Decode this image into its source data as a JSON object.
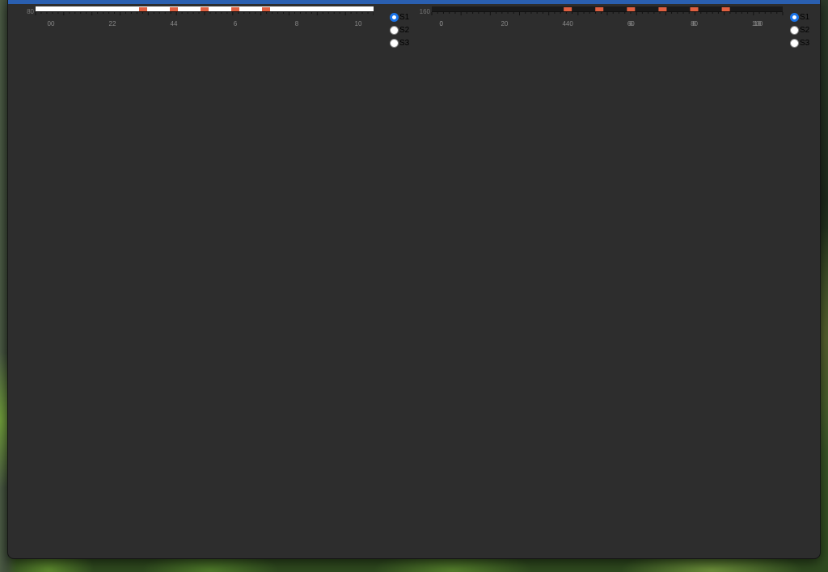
{
  "window": {
    "accent": "#2a5fb0",
    "background": "#2d2d2d"
  },
  "chart_data": [
    {
      "type": "scatter",
      "title": "",
      "xlabel": "",
      "ylabel": "",
      "y_visible_tick": "80",
      "x_tick_labels": [
        "00",
        "22",
        "44",
        "6",
        "8",
        "10"
      ],
      "x_tick_values": [
        0,
        2,
        4,
        6,
        8,
        10
      ],
      "xlim": [
        -0.5,
        10.5
      ],
      "marker_x": [
        3,
        4,
        5,
        6,
        7
      ],
      "series_color": "#e06040",
      "grid": false
    },
    {
      "type": "scatter",
      "title": "",
      "xlabel": "",
      "ylabel": "",
      "y_visible_tick": "160",
      "x_tick_labels": [
        "0",
        "0",
        "20",
        "440",
        "6",
        "60",
        "8",
        "80",
        "10",
        "100"
      ],
      "x_tick_values": [
        0,
        0,
        20,
        40,
        60,
        60,
        80,
        80,
        100,
        100
      ],
      "xlim": [
        -3,
        108
      ],
      "marker_x": [
        40,
        50,
        60,
        70,
        80,
        90
      ],
      "series_color": "#e06040",
      "grid": false
    }
  ],
  "left_series_selector": {
    "options": [
      "S1",
      "S2",
      "S3"
    ],
    "selected": "S1"
  },
  "right_series_selector": {
    "options": [
      "S1",
      "S2",
      "S3"
    ],
    "selected": "S1"
  }
}
